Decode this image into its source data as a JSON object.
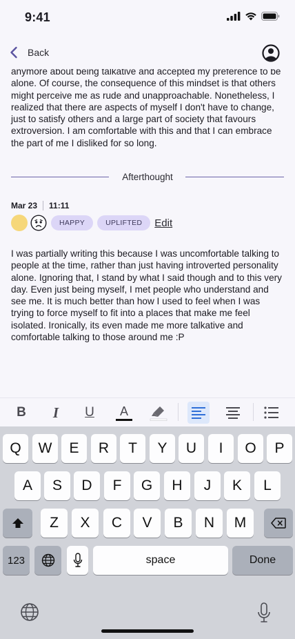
{
  "status": {
    "time": "9:41"
  },
  "nav": {
    "back_label": "Back"
  },
  "entry": {
    "previous_text": "anymore about being talkative and accepted my preference to be alone. Of course, the consequence of this mindset is that others might perceive me as rude and unapproachable. Nonetheless, I realized that there are aspects of myself I don't have to change, just to satisfy others and a large part of society that favours extroversion. I am comfortable with this and that I can embrace the part of me I disliked for so long.",
    "divider_label": "Afterthought",
    "date": "Mar 23",
    "time": "11:11",
    "tags": [
      "HAPPY",
      "UPLIFTED"
    ],
    "edit_label": "Edit",
    "afterthought_text": "I was partially writing this because I was uncomfortable talking to people at the time, rather than just having introverted personality alone. Ignoring that, I stand by what I said though and to this very day. Even just being myself, I met people who understand and see me. It is much better than how I used to feel when I was trying to force myself to fit into a places that make me feel isolated. Ironically, its even made me more talkative and comfortable talking to those around me :P"
  },
  "toolbar": {
    "bold": "B",
    "italic": "I",
    "underline": "U",
    "text_color": "A",
    "icons": [
      "bold-icon",
      "italic-icon",
      "underline-icon",
      "text-color-icon",
      "highlighter-icon",
      "align-left-icon",
      "align-center-icon",
      "bullet-list-icon"
    ]
  },
  "keyboard": {
    "row1": [
      "Q",
      "W",
      "E",
      "R",
      "T",
      "Y",
      "U",
      "I",
      "O",
      "P"
    ],
    "row2": [
      "A",
      "S",
      "D",
      "F",
      "G",
      "H",
      "J",
      "K",
      "L"
    ],
    "row3": [
      "Z",
      "X",
      "C",
      "V",
      "B",
      "N",
      "M"
    ],
    "numbers_label": "123",
    "space_label": "space",
    "done_label": "Done"
  },
  "colors": {
    "accent": "#6b63a8",
    "tag_bg": "#dcd6f7",
    "mood_yellow": "#f6d77a",
    "active_format": "#dde8fb"
  }
}
